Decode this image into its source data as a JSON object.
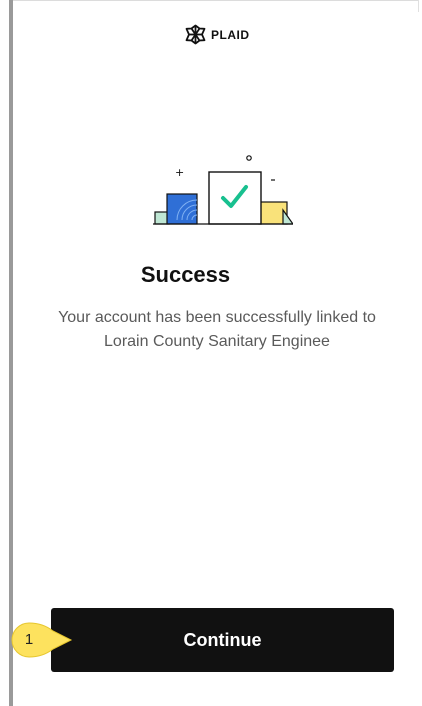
{
  "brand": {
    "name": "PLAID",
    "logo_icon": "plaid-logo-icon"
  },
  "illustration": {
    "icon": "success-illustration",
    "check_color": "#18c08f",
    "blue": "#2f6fd6",
    "yellow": "#f9e27a",
    "mint": "#bfe7d4"
  },
  "success": {
    "title": "Success",
    "message": "Your account has been successfully linked to Lorain County Sanitary Enginee"
  },
  "actions": {
    "continue_label": "Continue",
    "button_color": "#111111"
  },
  "step_marker": {
    "number": "1",
    "color": "#fde25e"
  }
}
